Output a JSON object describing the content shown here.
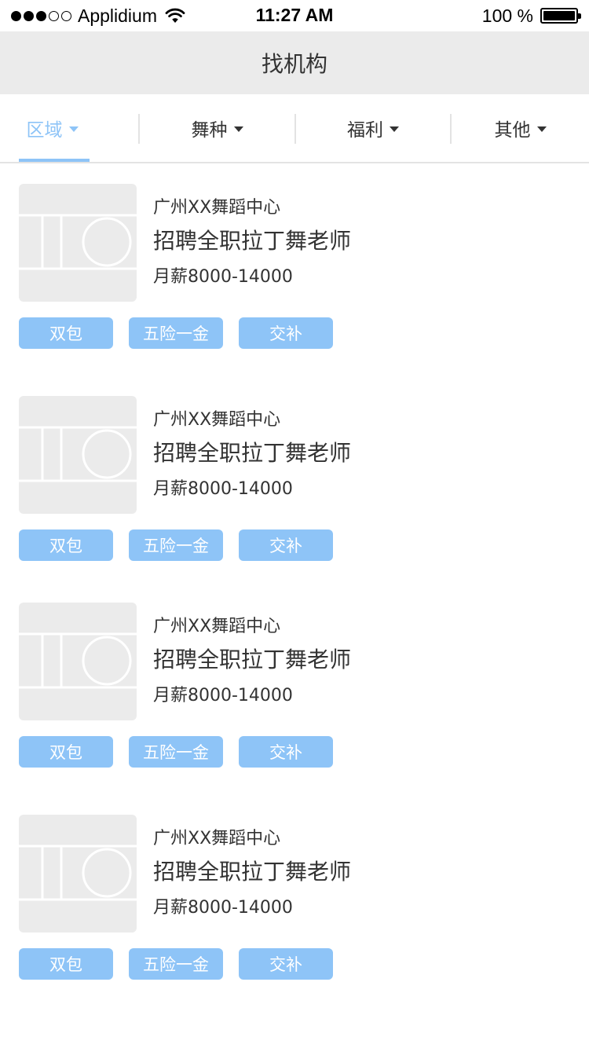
{
  "status_bar": {
    "carrier": "Applidium",
    "time": "11:27 AM",
    "battery": "100 %",
    "signal_strength_bars": 3,
    "signal_total_bars": 5,
    "battery_level": 1.0
  },
  "nav": {
    "title": "找机构"
  },
  "filters": [
    {
      "label": "区域",
      "active": true
    },
    {
      "label": "舞种",
      "active": false
    },
    {
      "label": "福利",
      "active": false
    },
    {
      "label": "其他",
      "active": false
    }
  ],
  "colors": {
    "accent": "#8ec4f7",
    "nav_background": "#ebebeb",
    "text": "#333333",
    "tag_text": "#ffffff",
    "placeholder": "#ebebeb"
  },
  "listings": [
    {
      "org": "广州XX舞蹈中心",
      "title": "招聘全职拉丁舞老师",
      "salary": "月薪8000-14000",
      "tags": [
        "双包",
        "五险一金",
        "交补"
      ]
    },
    {
      "org": "广州XX舞蹈中心",
      "title": "招聘全职拉丁舞老师",
      "salary": "月薪8000-14000",
      "tags": [
        "双包",
        "五险一金",
        "交补"
      ]
    },
    {
      "org": "广州XX舞蹈中心",
      "title": "招聘全职拉丁舞老师",
      "salary": "月薪8000-14000",
      "tags": [
        "双包",
        "五险一金",
        "交补"
      ]
    },
    {
      "org": "广州XX舞蹈中心",
      "title": "招聘全职拉丁舞老师",
      "salary": "月薪8000-14000",
      "tags": [
        "双包",
        "五险一金",
        "交补"
      ]
    }
  ]
}
